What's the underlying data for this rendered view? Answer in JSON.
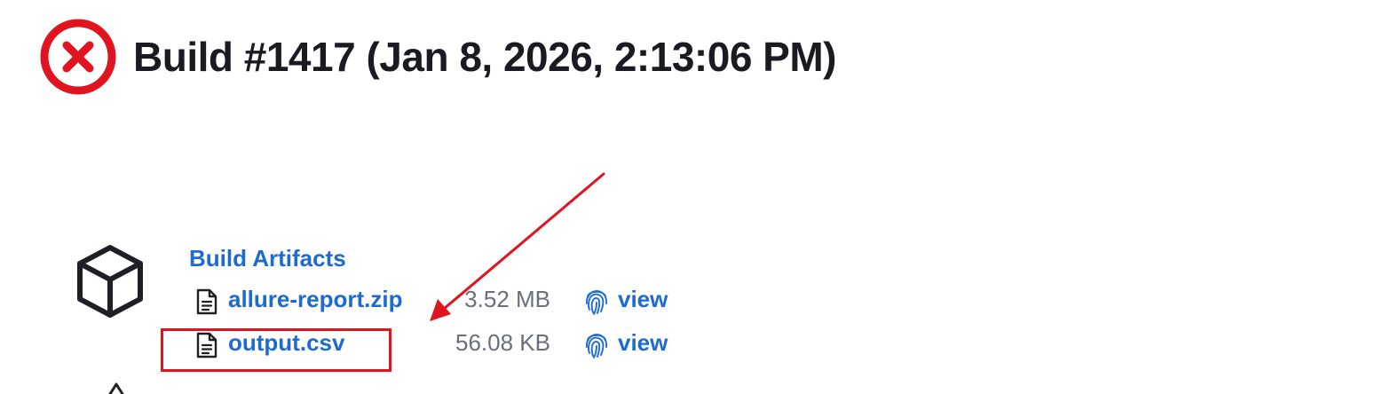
{
  "header": {
    "status": "failed",
    "status_icon": "error-x-icon",
    "title": "Build #1417 (Jan 8, 2026, 2:13:06 PM)"
  },
  "artifacts": {
    "icon": "package-box-icon",
    "heading": "Build Artifacts",
    "files": [
      {
        "name": "allure-report.zip",
        "size": "3.52 MB",
        "file_icon": "document-icon",
        "view_icon": "fingerprint-icon",
        "view_label": "view"
      },
      {
        "name": "output.csv",
        "size": "56.08 KB",
        "file_icon": "document-icon",
        "view_icon": "fingerprint-icon",
        "view_label": "view"
      }
    ]
  },
  "annotation": {
    "color": "#e0141e",
    "target": "output.csv"
  },
  "colors": {
    "link": "#1d6bd2",
    "failure": "#e0141e",
    "muted_text": "#6b6e7b",
    "title_text": "#1a1a22"
  }
}
